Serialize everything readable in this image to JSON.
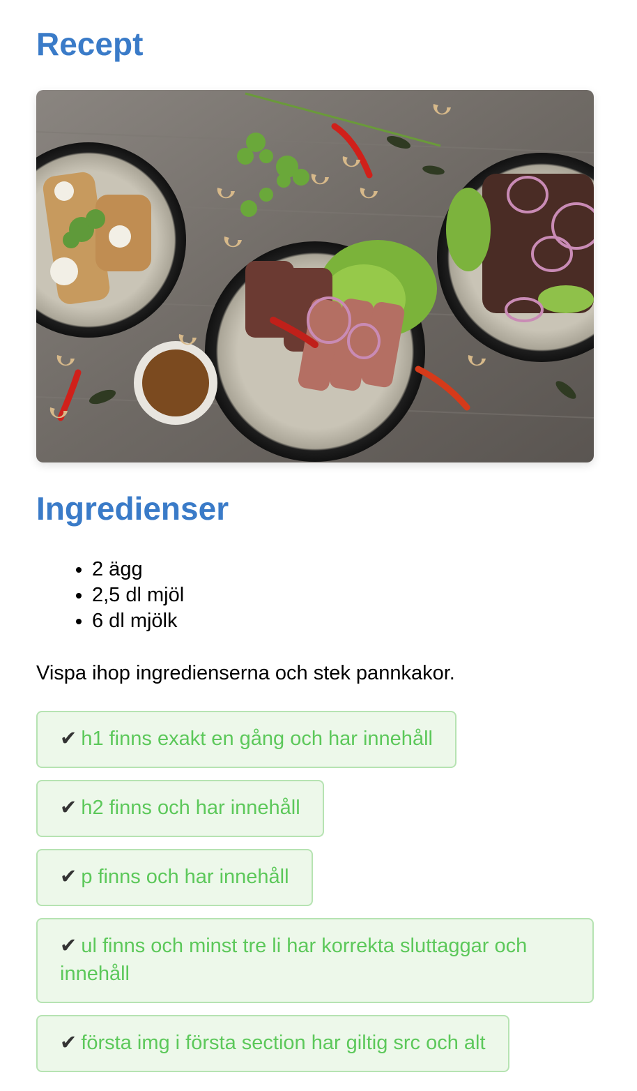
{
  "page": {
    "title": "Recept",
    "image_alt": "Bild på mat",
    "ingredients_heading": "Ingredienser",
    "ingredients": [
      "2 ägg",
      "2,5 dl mjöl",
      "6 dl mjölk"
    ],
    "instructions": "Vispa ihop ingredienserna och stek pannkakor."
  },
  "checks": {
    "tick_symbol": "✔",
    "items": [
      "h1 finns exakt en gång och har innehåll",
      "h2 finns och har innehåll",
      "p finns och har innehåll",
      "ul finns och minst tre li har korrekta sluttaggar och innehåll",
      "första img i första section har giltig src och alt"
    ]
  },
  "colors": {
    "heading": "#3a7bc8",
    "check_text": "#5cc85a",
    "check_bg": "#edf8ea",
    "check_border": "#b6e3b2"
  }
}
